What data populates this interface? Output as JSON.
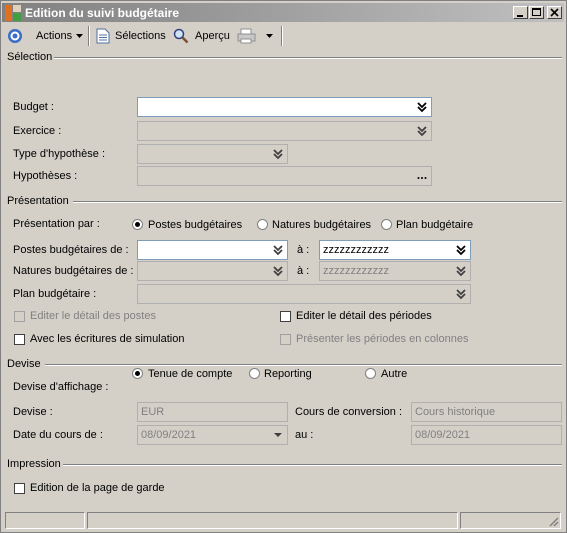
{
  "window": {
    "title": "Edition du suivi budgétaire",
    "colors": {
      "chrome": "#d4d0c8",
      "field_border": "#7f9db9",
      "disabled_text": "#808080"
    }
  },
  "toolbar": {
    "actions": "Actions",
    "selections": "Sélections",
    "apercu": "Aperçu"
  },
  "selection": {
    "title": "Sélection",
    "budget_label": "Budget :",
    "exercice_label": "Exercice :",
    "type_hypothese_label": "Type d'hypothèse :",
    "hypotheses_label": "Hypothèses :"
  },
  "presentation": {
    "title": "Présentation",
    "par_label": "Présentation par :",
    "options": [
      "Postes budgétaires",
      "Natures budgétaires",
      "Plan budgétaire"
    ],
    "selected": "Postes budgétaires",
    "postes_label": "Postes budgétaires de :",
    "postes_from": "",
    "a_label": "à :",
    "postes_to": "zzzzzzzzzzzz",
    "natures_label": "Natures budgétaires de :",
    "natures_to": "zzzzzzzzzzzz",
    "plan_label": "Plan budgétaire :",
    "chk_detail_postes": "Editer le détail des postes",
    "chk_detail_periodes": "Editer le détail des périodes",
    "chk_simulation": "Avec les écritures de simulation",
    "chk_periodes_colonnes": "Présenter les périodes en colonnes"
  },
  "devise": {
    "title": "Devise",
    "affichage_label": "Devise d'affichage :",
    "options": [
      "Tenue de compte",
      "Reporting",
      "Autre"
    ],
    "selected": "Tenue de compte",
    "devise_label": "Devise :",
    "devise_value": "EUR",
    "cours_label": "Cours de conversion :",
    "cours_value": "Cours historique",
    "date_label": "Date du cours de :",
    "date_value": "08/09/2021",
    "au_label": "au :",
    "au_value": "08/09/2021"
  },
  "impression": {
    "title": "Impression",
    "chk_page_garde": "Edition de la page de garde"
  }
}
